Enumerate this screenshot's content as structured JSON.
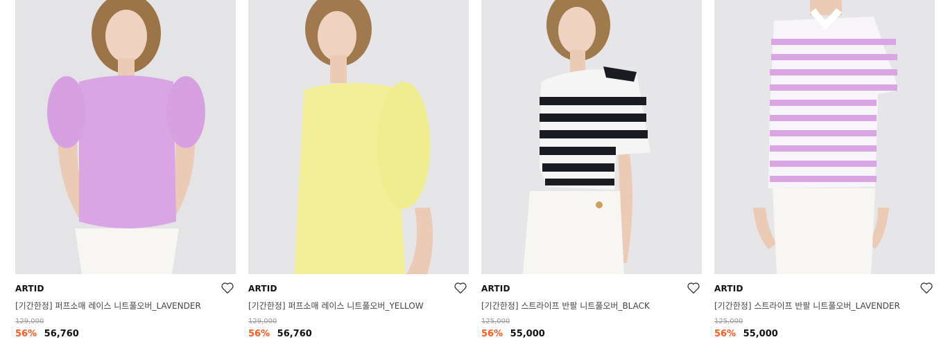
{
  "products": [
    {
      "brand": "ARTID",
      "name": "[기간한정] 퍼프소매 레이스 니트풀오버_LAVENDER",
      "original_price": "129,000",
      "discount_rate": "56%",
      "sale_price": "56,760",
      "wishlist_icon": "heart-outline-icon",
      "garment_color": "#d9a6e3"
    },
    {
      "brand": "ARTID",
      "name": "[기간한정] 퍼프소매 레이스 니트풀오버_YELLOW",
      "original_price": "129,000",
      "discount_rate": "56%",
      "sale_price": "56,760",
      "wishlist_icon": "heart-outline-icon",
      "garment_color": "#f2ef98"
    },
    {
      "brand": "ARTID",
      "name": "[기간한정] 스트라이프 반팔 니트풀오버_BLACK",
      "original_price": "125,000",
      "discount_rate": "56%",
      "sale_price": "55,000",
      "wishlist_icon": "heart-outline-icon",
      "garment_color": "#1b1b22"
    },
    {
      "brand": "ARTID",
      "name": "[기간한정] 스트라이프 반팔 니트풀오버_LAVENDER",
      "original_price": "125,000",
      "discount_rate": "56%",
      "sale_price": "55,000",
      "wishlist_icon": "heart-outline-icon",
      "garment_color": "#d9a6e3"
    }
  ],
  "colors": {
    "discount": "#ff5a1f",
    "original_price": "#999999",
    "photo_background": "#e4e4e6"
  }
}
